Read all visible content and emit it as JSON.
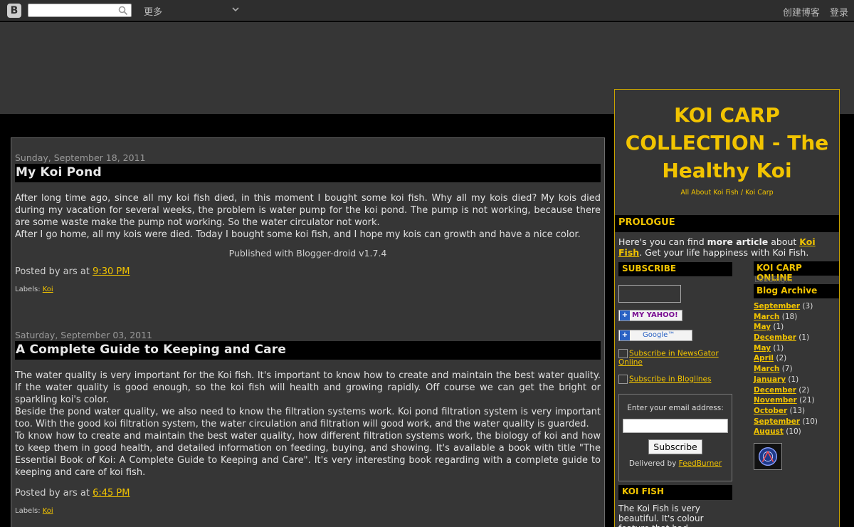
{
  "navbar": {
    "logo_letter": "B",
    "more_label": "更多",
    "create_blog": "创建博客",
    "sign_in": "登录"
  },
  "posts": [
    {
      "date": "Sunday, September 18, 2011",
      "title": "My Koi Pond",
      "paragraphs": [
        " After long time ago, since all my koi fish died, in this moment I bought some koi fish. Why all my kois died? My kois died during my vacation for several weeks, the problem is water pump for the koi pond. The pump is not working, because there are some waste make the pump not working. So the water circulator not work.",
        "After I go home, all my kois were died. Today I bought some koi fish, and I hope my kois can growth and have a nice color."
      ],
      "published_with": "Published with Blogger-droid v1.7.4",
      "posted_by": "Posted by ars at ",
      "time": "9:30 PM",
      "labels_prefix": "Labels: ",
      "label": "Koi"
    },
    {
      "date": "Saturday, September 03, 2011",
      "title": "A Complete Guide to Keeping and Care",
      "paragraphs": [
        " The water quality is very important for the Koi fish. It's important to know how to create and maintain the best water quality. If the water quality is good enough, so the koi fish will health and growing rapidly. Off course we can get the bright or sparkling koi's color.",
        "Beside the pond water quality, we also need to know the filtration systems work. Koi pond filtration system is very important too. With the good koi filtration system, the water circulation and filtration will good work, and the water quality is guarded.",
        "To know how to create and maintain the best water quality, how different filtration systems work, the biology of koi and how to keep them in good health, and detailed information on feeding, buying, and showing. It's available a book with title \"The Essential Book of Koi: A Complete Guide to Keeping and Care\". It's very interesting book regarding with a complete guide to keeping and care of koi fish."
      ],
      "posted_by": "Posted by ars at ",
      "time": "6:45 PM",
      "labels_prefix": "Labels: ",
      "label": "Koi"
    }
  ],
  "sidebar": {
    "blog_title": "KOI CARP COLLECTION - The Healthy Koi",
    "blog_description": "All About Koi Fish / Koi Carp",
    "prologue": {
      "heading": "PROLOGUE",
      "text_1": "Here's you can find ",
      "bold": "more article",
      "text_2": " about ",
      "link": "Koi Fish",
      "text_3": ". Get your life happiness with Koi Fish."
    },
    "subscribe": {
      "heading": "SUBSCRIBE",
      "yahoo": "MY YAHOO!",
      "google": "Google™",
      "newsgator": "Subscribe in NewsGator Online",
      "bloglines": "Subscribe in Bloglines",
      "email_prompt": "Enter your email address:",
      "email_value": "",
      "button": "Subscribe",
      "delivered_by": "Delivered by ",
      "feedburner": "FeedBurner"
    },
    "koi_fish": {
      "heading": "KOI FISH",
      "text": "The Koi Fish is very beautiful. It's colour feature that had"
    },
    "online": {
      "heading": "KOI CARP ONLINE",
      "loading": "Loading..."
    },
    "archive": {
      "heading": "Blog Archive",
      "items": [
        {
          "month": "September",
          "count": "(3)"
        },
        {
          "month": "March",
          "count": "(18)"
        },
        {
          "month": "May",
          "count": "(1)"
        },
        {
          "month": "December",
          "count": "(1)"
        },
        {
          "month": "May",
          "count": "(1)"
        },
        {
          "month": "April",
          "count": "(2)"
        },
        {
          "month": "March",
          "count": "(7)"
        },
        {
          "month": "January",
          "count": "(1)"
        },
        {
          "month": "December",
          "count": "(2)"
        },
        {
          "month": "November",
          "count": "(21)"
        },
        {
          "month": "October",
          "count": "(13)"
        },
        {
          "month": "September",
          "count": "(10)"
        },
        {
          "month": "August",
          "count": "(10)"
        }
      ]
    }
  },
  "colors": {
    "accent": "#f2c400",
    "background": "#000000",
    "panel": "#363636"
  }
}
